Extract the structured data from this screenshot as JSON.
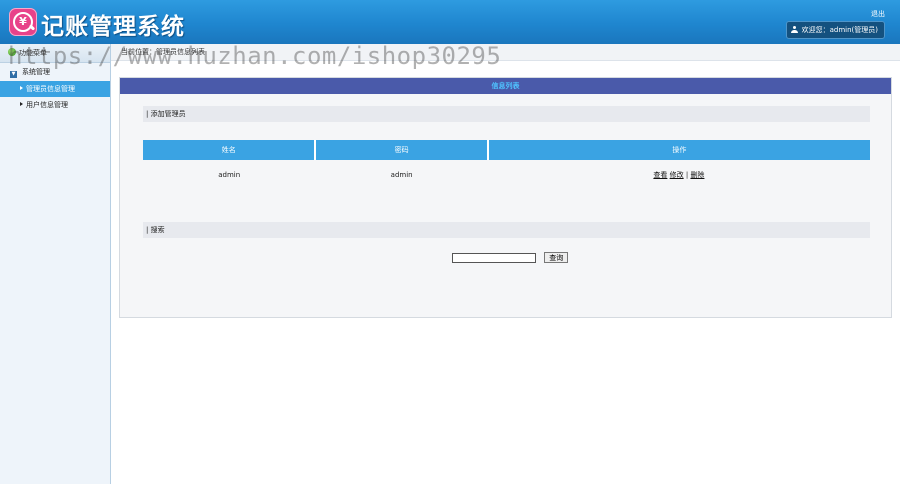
{
  "header": {
    "title": "记账管理系统",
    "logo_glyph": "¥",
    "logout_label": "退出",
    "welcome": "欢迎您：admin(管理员)"
  },
  "sidebar": {
    "heading": "功能菜单",
    "group_label": "系统管理",
    "group_toggle_glyph": "▼",
    "items": [
      {
        "label": "管理员信息管理",
        "active": true
      },
      {
        "label": "用户信息管理",
        "active": false
      }
    ]
  },
  "breadcrumb": "当前位置：管理员信息列表",
  "watermark": "https://www.huzhan.com/ishop30295",
  "main": {
    "panel_title": "信息列表",
    "add_section": "| 添加管理员",
    "table": {
      "columns": [
        "姓名",
        "密码",
        "操作"
      ],
      "rows": [
        {
          "name": "admin",
          "password": "admin",
          "actions": [
            "查看",
            "修改",
            "删除"
          ]
        }
      ]
    },
    "search_section": "| 搜索",
    "search": {
      "value": "",
      "button_label": "查询"
    }
  },
  "colors": {
    "header_blue": "#1f86cf",
    "panel_title_bg": "#4a5aaa",
    "table_header_bg": "#3aa3e3",
    "sidebar_active_bg": "#3aa3e3"
  }
}
